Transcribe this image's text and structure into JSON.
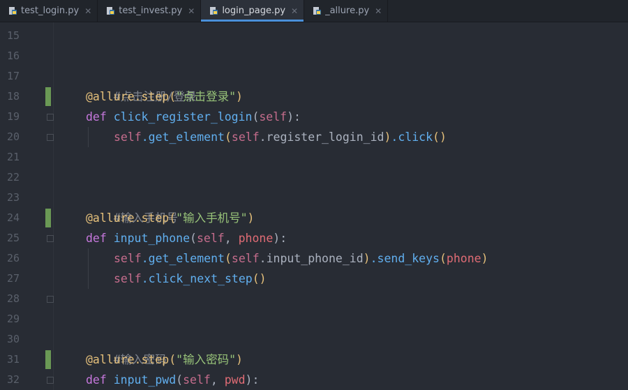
{
  "tabs": [
    {
      "label": "test_login.py",
      "active": false
    },
    {
      "label": "test_invest.py",
      "active": false
    },
    {
      "label": "login_page.py",
      "active": true
    },
    {
      "label": "_allure.py",
      "active": false
    }
  ],
  "line_numbers": [
    "15",
    "16",
    "17",
    "18",
    "19",
    "20",
    "21",
    "22",
    "23",
    "24",
    "25",
    "26",
    "27",
    "28",
    "29",
    "30",
    "31",
    "32"
  ],
  "code": {
    "l17": {
      "comment": "#点击注册/登录"
    },
    "l18": {
      "deco": "@allure.step(",
      "str": "\"点击登录\"",
      "close": ")"
    },
    "l19": {
      "kw": "def ",
      "fn": "click_register_login",
      "open": "(",
      "self": "self",
      "close": "):"
    },
    "l20": {
      "self1": "self",
      "m1": ".get_element",
      "p1": "(",
      "self2": "self",
      "attr": ".register_login_id",
      "p2": ")",
      "m2": ".click",
      "p3": "()"
    },
    "l23": {
      "comment": "#输入手机号"
    },
    "l24": {
      "deco": "@allure.step(",
      "str": "\"输入手机号\"",
      "close": ")"
    },
    "l25": {
      "kw": "def ",
      "fn": "input_phone",
      "open": "(",
      "self": "self",
      "comma": ", ",
      "param": "phone",
      "close": "):"
    },
    "l26": {
      "self1": "self",
      "m1": ".get_element",
      "p1": "(",
      "self2": "self",
      "attr": ".input_phone_id",
      "p2": ")",
      "m2": ".send_keys",
      "p3": "(",
      "arg": "phone",
      "p4": ")"
    },
    "l27": {
      "self1": "self",
      "m1": ".click_next_step",
      "p1": "()"
    },
    "l30": {
      "comment": "#输入密码"
    },
    "l31": {
      "deco": "@allure.step(",
      "str": "\"输入密码\"",
      "close": ")"
    },
    "l32": {
      "kw": "def ",
      "fn": "input_pwd",
      "open": "(",
      "self": "self",
      "comma": ", ",
      "param": "pwd",
      "close": "):"
    }
  },
  "icons": {
    "tab_file": "python-file-icon",
    "tab_close": "close-icon"
  },
  "colors": {
    "background": "#282c34",
    "active_tab_accent": "#4a90d9",
    "change_bar": "#6a9955"
  }
}
